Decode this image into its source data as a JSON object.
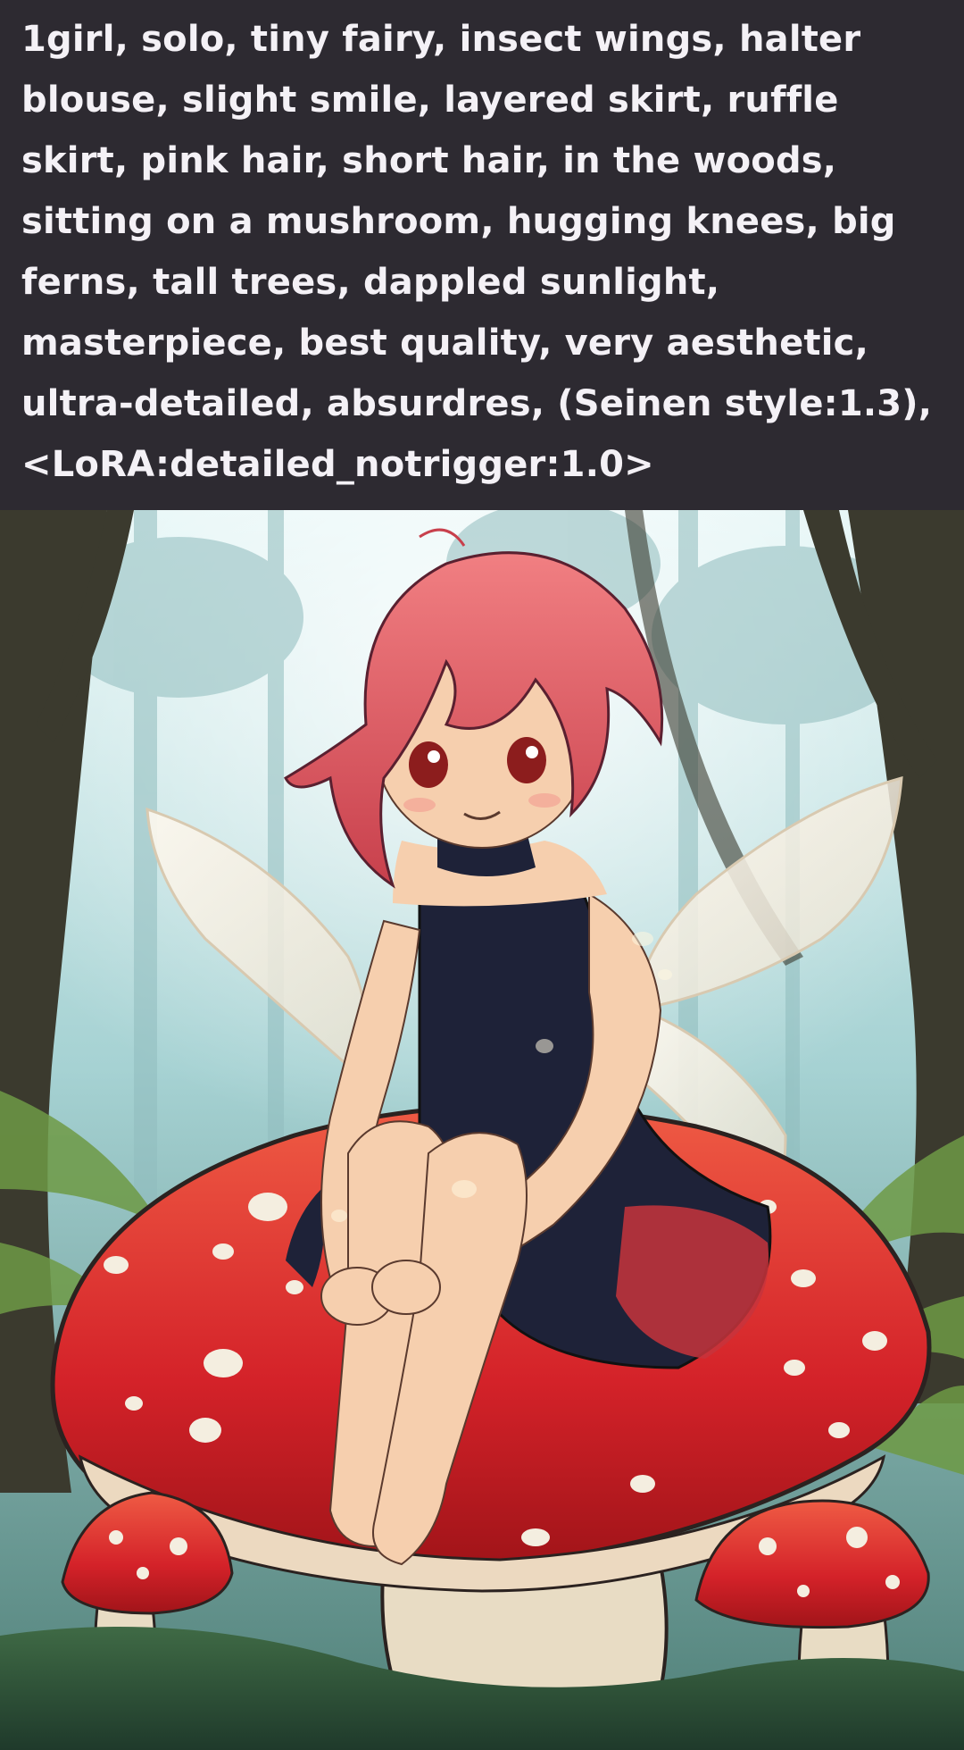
{
  "prompt": {
    "text": "1girl, solo, tiny fairy, insect wings, halter blouse, slight smile, layered skirt, ruffle skirt, pink hair, short hair, in the woods, sitting on a mushroom, hugging knees, big ferns, tall trees, dappled sunlight, masterpiece, best quality, very aesthetic, ultra-detailed, absurdres, (Seinen style:1.3),<LoRA:detailed_notrigger:1.0>"
  },
  "colors": {
    "panel_background": "#2d2a31",
    "prompt_text": "#f4f1f6",
    "forest_light": "#d7eef0",
    "forest_mid": "#7fb0b3",
    "forest_dark": "#2f4f4c",
    "tree_trunk": "#3b3a2e",
    "mushroom_cap": "#d7262b",
    "mushroom_spot": "#f4eee0",
    "mushroom_stem": "#e8dcc4",
    "hair": "#e45b63",
    "skin": "#f6cfae",
    "wings": "#f6f0e6",
    "dress": "#1e2238",
    "ruffle_accent": "#c7343c",
    "grass": "#5f8f3a"
  },
  "image": {
    "subject_icon": "fairy-on-mushroom-illustration"
  }
}
